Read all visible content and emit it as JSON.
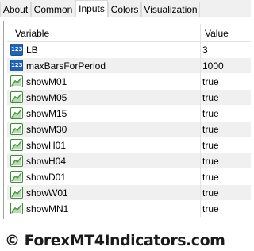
{
  "tabs": [
    {
      "label": "About",
      "active": false
    },
    {
      "label": "Common",
      "active": false
    },
    {
      "label": "Inputs",
      "active": true
    },
    {
      "label": "Colors",
      "active": false
    },
    {
      "label": "Visualization",
      "active": false
    }
  ],
  "table": {
    "columns": [
      "Variable",
      "Value"
    ],
    "rows": [
      {
        "icon": "integer-icon",
        "icon_text": "123",
        "name": "LB",
        "value": "3"
      },
      {
        "icon": "integer-icon",
        "icon_text": "123",
        "name": "maxBarsForPeriod",
        "value": "1000"
      },
      {
        "icon": "boolean-icon",
        "name": "showM01",
        "value": "true"
      },
      {
        "icon": "boolean-icon",
        "name": "showM05",
        "value": "true"
      },
      {
        "icon": "boolean-icon",
        "name": "showM15",
        "value": "true"
      },
      {
        "icon": "boolean-icon",
        "name": "showM30",
        "value": "true"
      },
      {
        "icon": "boolean-icon",
        "name": "showH01",
        "value": "true"
      },
      {
        "icon": "boolean-icon",
        "name": "showH04",
        "value": "true"
      },
      {
        "icon": "boolean-icon",
        "name": "showD01",
        "value": "true"
      },
      {
        "icon": "boolean-icon",
        "name": "showW01",
        "value": "true"
      },
      {
        "icon": "boolean-icon",
        "name": "showMN1",
        "value": "true"
      }
    ]
  },
  "watermark": "© ForexMT4Indicators.com",
  "colors": {
    "integer_icon": "#1f63b6",
    "boolean_icon": "#3e8c38",
    "row_shade": "#f0f0f0"
  }
}
